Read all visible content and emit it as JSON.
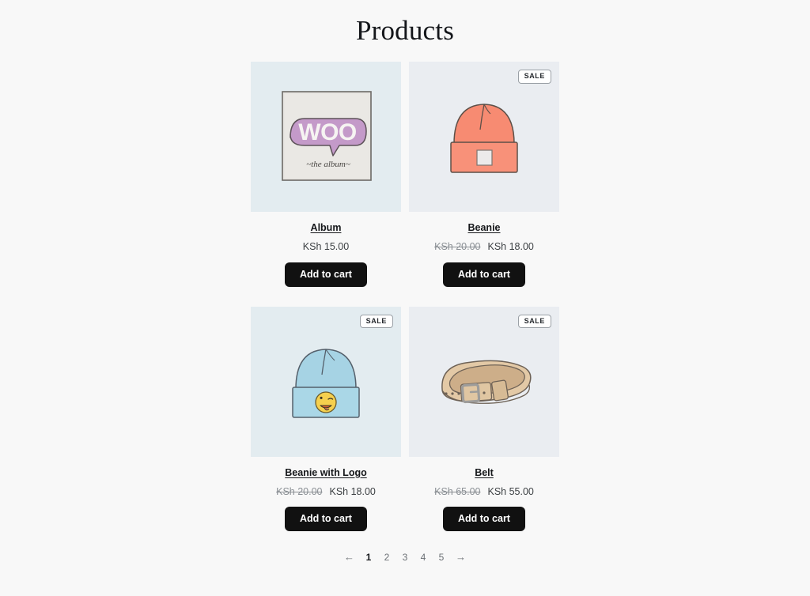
{
  "header": {
    "title": "Products"
  },
  "products": [
    {
      "name": "Album",
      "image_icon": "woo-album-cover-image",
      "bg": "#e3ecf0",
      "on_sale": false,
      "sale_label": "SALE",
      "regular_price": "",
      "price": "KSh 15.00",
      "add_to_cart_label": "Add to cart"
    },
    {
      "name": "Beanie",
      "image_icon": "coral-beanie-image",
      "bg": "#eaedf1",
      "on_sale": true,
      "sale_label": "SALE",
      "regular_price": "KSh 20.00",
      "price": "KSh 18.00",
      "add_to_cart_label": "Add to cart"
    },
    {
      "name": "Beanie with Logo",
      "image_icon": "blue-beanie-logo-image",
      "bg": "#e3ecf0",
      "on_sale": true,
      "sale_label": "SALE",
      "regular_price": "KSh 20.00",
      "price": "KSh 18.00",
      "add_to_cart_label": "Add to cart"
    },
    {
      "name": "Belt",
      "image_icon": "tan-leather-belt-image",
      "bg": "#eaedf1",
      "on_sale": true,
      "sale_label": "SALE",
      "regular_price": "KSh 65.00",
      "price": "KSh 55.00",
      "add_to_cart_label": "Add to cart"
    }
  ],
  "pagination": {
    "prev_label": "←",
    "next_label": "→",
    "pages": [
      "1",
      "2",
      "3",
      "4",
      "5"
    ],
    "current": "1"
  },
  "colors": {
    "page_bg": "#f8f8f8",
    "button_bg": "#111111",
    "text": "#15171a",
    "muted": "#6b7075"
  }
}
